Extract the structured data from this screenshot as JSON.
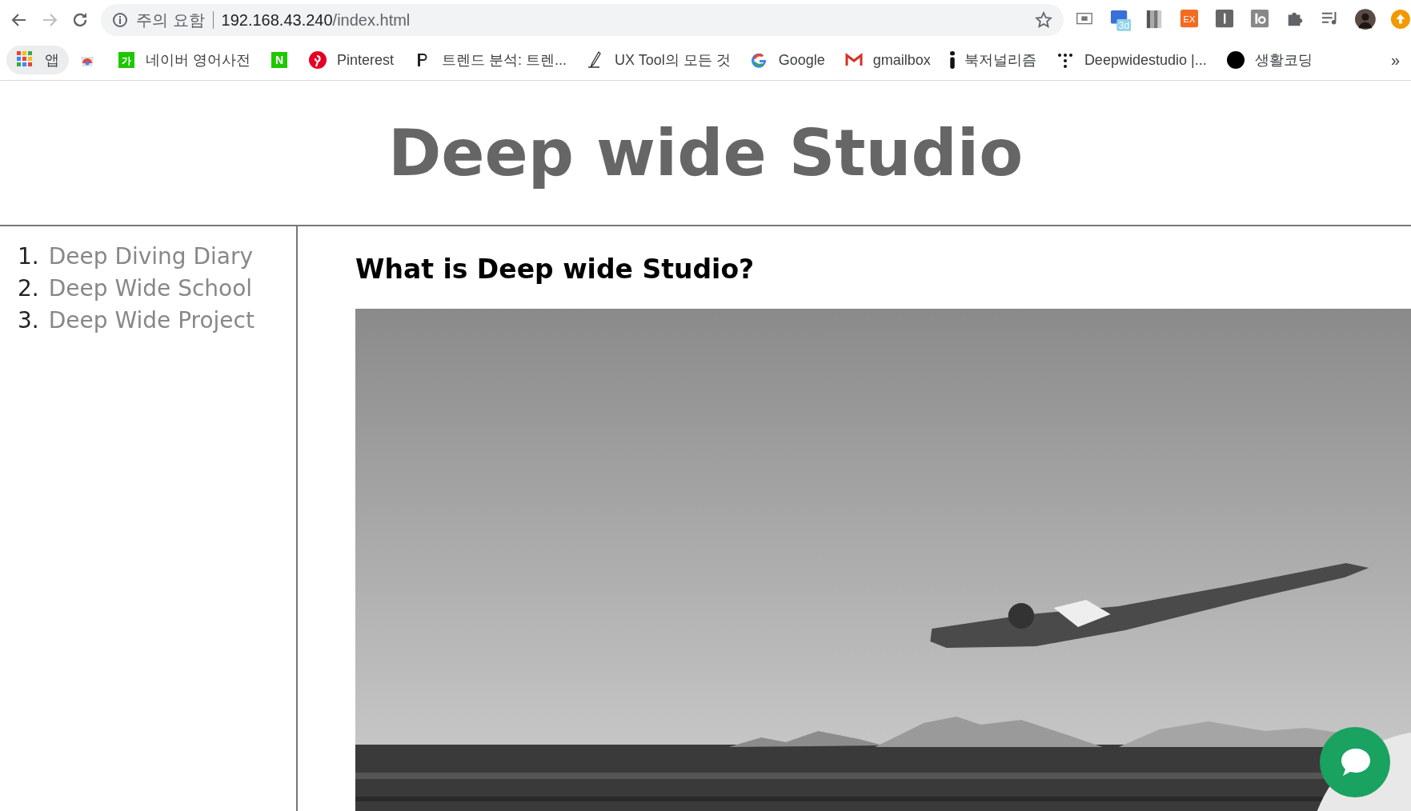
{
  "browser": {
    "back_enabled": true,
    "forward_enabled": false,
    "security_label": "주의 요함",
    "url_host": "192.168.43.240",
    "url_path": "/index.html",
    "extensions": [
      {
        "kind": "news"
      },
      {
        "kind": "badge3d",
        "label": "3d"
      },
      {
        "kind": "stripes"
      },
      {
        "kind": "ex",
        "label": "EX"
      },
      {
        "kind": "bar"
      },
      {
        "kind": "tb"
      },
      {
        "kind": "puzzle"
      },
      {
        "kind": "playlist"
      },
      {
        "kind": "avatar"
      },
      {
        "kind": "update"
      }
    ]
  },
  "bookmarks": [
    {
      "kind": "apps",
      "label": "앱"
    },
    {
      "kind": "store"
    },
    {
      "kind": "dict",
      "label": "네이버 영어사전",
      "badge": "가"
    },
    {
      "kind": "naver",
      "badge": "N"
    },
    {
      "kind": "pinterest",
      "label": "Pinterest"
    },
    {
      "kind": "serif-p",
      "label": "트렌드 분석: 트렌..."
    },
    {
      "kind": "pen",
      "label": "UX Tool의 모든 것"
    },
    {
      "kind": "google",
      "label": "Google"
    },
    {
      "kind": "gmail",
      "label": "gmailbox"
    },
    {
      "kind": "info",
      "label": "북저널리즘"
    },
    {
      "kind": "dots",
      "label": "Deepwidestudio |..."
    },
    {
      "kind": "circle",
      "label": "생활코딩"
    }
  ],
  "more": "»",
  "page": {
    "title": "Deep wide Studio",
    "nav": [
      {
        "number": "1.",
        "label": "Deep Diving Diary"
      },
      {
        "number": "2.",
        "label": "Deep Wide School"
      },
      {
        "number": "3.",
        "label": "Deep Wide Project"
      }
    ],
    "heading": "What is Deep wide Studio?"
  }
}
